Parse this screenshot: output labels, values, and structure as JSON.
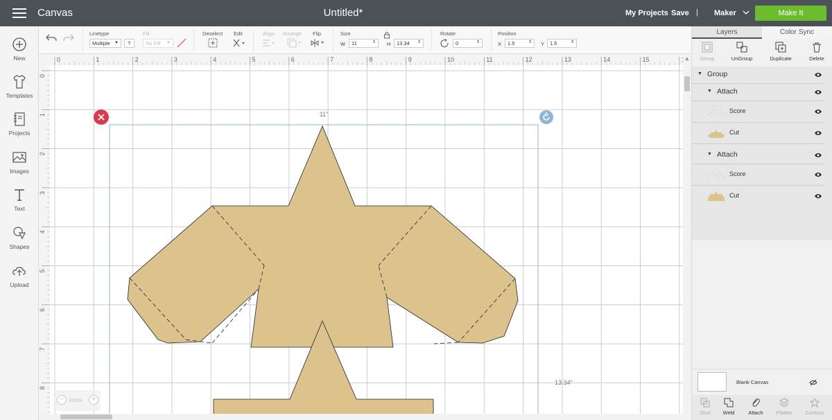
{
  "topbar": {
    "app_title": "Canvas",
    "doc_title": "Untitled*",
    "my_projects": "My Projects",
    "save": "Save",
    "separator": "|",
    "machine": "Maker",
    "make_it": "Make It",
    "colors": {
      "bar": "#4a5258",
      "make_it": "#6dbb2e"
    }
  },
  "leftbar": {
    "items": [
      {
        "label": "New",
        "icon": "plus-circle-icon"
      },
      {
        "label": "Templates",
        "icon": "shirt-icon"
      },
      {
        "label": "Projects",
        "icon": "notebook-icon"
      },
      {
        "label": "Images",
        "icon": "image-icon"
      },
      {
        "label": "Text",
        "icon": "text-t-icon"
      },
      {
        "label": "Shapes",
        "icon": "shapes-icon"
      },
      {
        "label": "Upload",
        "icon": "cloud-upload-icon"
      }
    ]
  },
  "toolbar": {
    "linetype_label": "Linetype",
    "linetype_value": "Multiple",
    "linetype_help": "?",
    "fill_label": "Fill",
    "fill_value": "No Fill",
    "deselect_label": "Deselect",
    "edit_label": "Edit",
    "align_label": "Align",
    "arrange_label": "Arrange",
    "flip_label": "Flip",
    "size_label": "Size",
    "w_label": "W",
    "w_value": "11",
    "h_label": "H",
    "h_value": "13.34",
    "rotate_label": "Rotate",
    "rotate_value": "0",
    "position_label": "Position",
    "x_label": "X",
    "x_value": "1.5",
    "y_label": "Y",
    "y_value": "1.5"
  },
  "canvas": {
    "ruler_top": [
      "0",
      "1",
      "2",
      "3",
      "4",
      "5",
      "6",
      "7",
      "8",
      "9",
      "10",
      "11",
      "12",
      "13",
      "14",
      "15",
      "16"
    ],
    "ruler_left": [
      "0",
      "1",
      "2",
      "3",
      "4",
      "5",
      "6",
      "7",
      "8"
    ],
    "width_readout": "11\"",
    "height_readout": "13.34\"",
    "zoom": "100%",
    "shape_fill": "#dcc38d",
    "selection_color": "#8fb4d6"
  },
  "rightpanel": {
    "tabs": [
      "Layers",
      "Color Sync"
    ],
    "actions": [
      {
        "label": "Group",
        "icon": "group-icon",
        "enabled": false
      },
      {
        "label": "UnGroup",
        "icon": "ungroup-icon",
        "enabled": true
      },
      {
        "label": "Duplicate",
        "icon": "duplicate-icon",
        "enabled": true
      },
      {
        "label": "Delete",
        "icon": "trash-icon",
        "enabled": true
      }
    ],
    "layers": {
      "group": "Group",
      "attach1": "Attach",
      "attach1_score": "Score",
      "attach1_cut": "Cut",
      "attach2": "Attach",
      "attach2_score": "Score",
      "attach2_cut": "Cut"
    },
    "blank_canvas": "Blank Canvas",
    "bottom_actions": [
      {
        "label": "Slice",
        "icon": "slice-icon",
        "enabled": false
      },
      {
        "label": "Weld",
        "icon": "weld-icon",
        "enabled": true
      },
      {
        "label": "Attach",
        "icon": "attach-icon",
        "enabled": true
      },
      {
        "label": "Flatten",
        "icon": "flatten-icon",
        "enabled": false
      },
      {
        "label": "Contour",
        "icon": "contour-icon",
        "enabled": false
      }
    ]
  }
}
